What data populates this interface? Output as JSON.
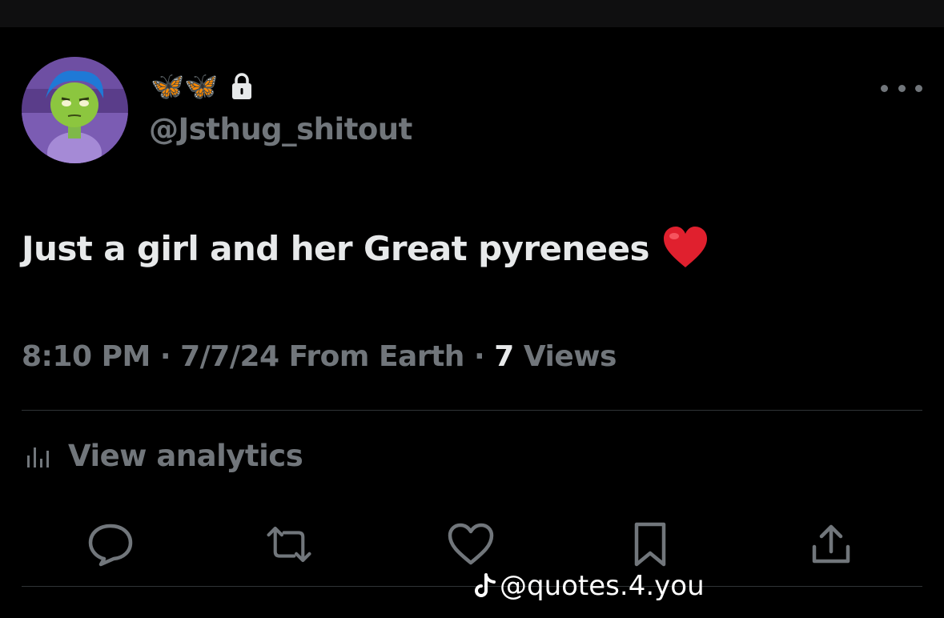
{
  "account": {
    "display_name": "🦋🦋",
    "handle": "@Jsthug_shitout",
    "protected": true
  },
  "tweet": {
    "text": "Just a girl and her Great pyrenees",
    "emoji": "heart-emoji",
    "time": "8:10 PM",
    "separator": "·",
    "date": "7/7/24",
    "source": "From Earth",
    "views_count": "7",
    "views_label": "Views"
  },
  "analytics": {
    "label": "View analytics"
  },
  "actions": [
    {
      "name": "reply",
      "icon": "reply-icon"
    },
    {
      "name": "repost",
      "icon": "repost-icon"
    },
    {
      "name": "like",
      "icon": "heart-icon"
    },
    {
      "name": "bookmark",
      "icon": "bookmark-icon"
    },
    {
      "name": "share",
      "icon": "share-icon"
    }
  ],
  "watermark": {
    "text": "@quotes.4.you",
    "icon": "tiktok-icon"
  },
  "colors": {
    "background": "#000000",
    "primary_text": "#e7e9ea",
    "secondary_text": "#71767b",
    "divider": "#2f3336",
    "butterfly": "#3fa9f5",
    "heart": "#e0202e"
  }
}
